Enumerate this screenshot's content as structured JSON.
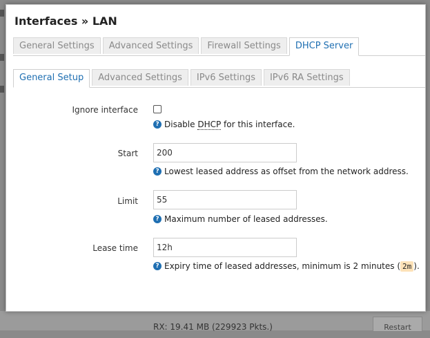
{
  "background": {
    "rx_text": "RX: 19.41 MB (229923 Pkts.)",
    "restart_label": "Restart"
  },
  "modal": {
    "title": "Interfaces » LAN"
  },
  "outer_tabs": [
    {
      "label": "General Settings",
      "active": false
    },
    {
      "label": "Advanced Settings",
      "active": false
    },
    {
      "label": "Firewall Settings",
      "active": false
    },
    {
      "label": "DHCP Server",
      "active": true
    }
  ],
  "inner_tabs": [
    {
      "label": "General Setup",
      "active": true
    },
    {
      "label": "Advanced Settings",
      "active": false
    },
    {
      "label": "IPv6 Settings",
      "active": false
    },
    {
      "label": "IPv6 RA Settings",
      "active": false
    }
  ],
  "form": {
    "ignore": {
      "label": "Ignore interface",
      "checked": false,
      "help_pre": "Disable ",
      "help_abbr": "DHCP",
      "help_post": " for this interface."
    },
    "start": {
      "label": "Start",
      "value": "200",
      "help": "Lowest leased address as offset from the network address."
    },
    "limit": {
      "label": "Limit",
      "value": "55",
      "help": "Maximum number of leased addresses."
    },
    "lease": {
      "label": "Lease time",
      "value": "12h",
      "help_pre": "Expiry time of leased addresses, minimum is 2 minutes (",
      "help_code": "2m",
      "help_post": ")."
    }
  },
  "colors": {
    "accent": "#1f6fb2",
    "code_bg": "#fde2b8"
  }
}
